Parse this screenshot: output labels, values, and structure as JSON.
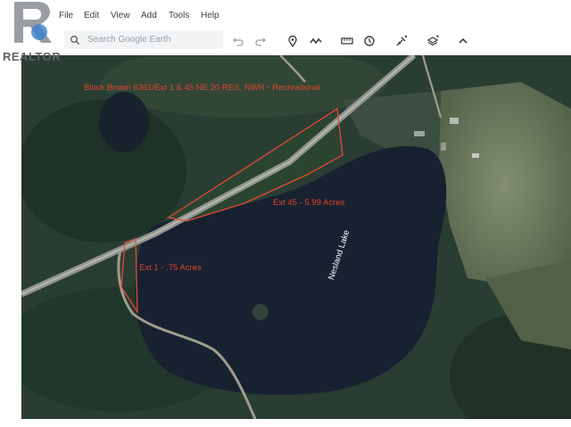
{
  "menu": {
    "items": [
      {
        "label": "File"
      },
      {
        "label": "Edit"
      },
      {
        "label": "View"
      },
      {
        "label": "Add"
      },
      {
        "label": "Tools"
      },
      {
        "label": "Help"
      }
    ]
  },
  "toolbar": {
    "search_placeholder": "Search Google Earth",
    "tools": [
      {
        "icon": "undo-icon"
      },
      {
        "icon": "redo-icon"
      },
      {
        "icon": "placemark-icon"
      },
      {
        "icon": "path-icon"
      },
      {
        "icon": "ruler-icon"
      },
      {
        "icon": "historical-imagery-icon"
      },
      {
        "icon": "satellite-add-icon"
      },
      {
        "icon": "layers-add-icon"
      },
      {
        "icon": "chevron-up-icon"
      }
    ]
  },
  "logo": {
    "text": "REALTOR"
  },
  "map": {
    "labels": {
      "block": "Block Brown 6361/Ext 1 & 45 NE 20-RES, NWR - Recreational",
      "ext45": "Ext 45 - 5.99 Acres",
      "ext1": "Ext 1 - .75 Acres",
      "lake": "Nesland Lake"
    },
    "colors": {
      "boundary": "#e2442f",
      "water": "#101a2a",
      "forest": "#233a26",
      "field": "#6b7a5a"
    }
  }
}
